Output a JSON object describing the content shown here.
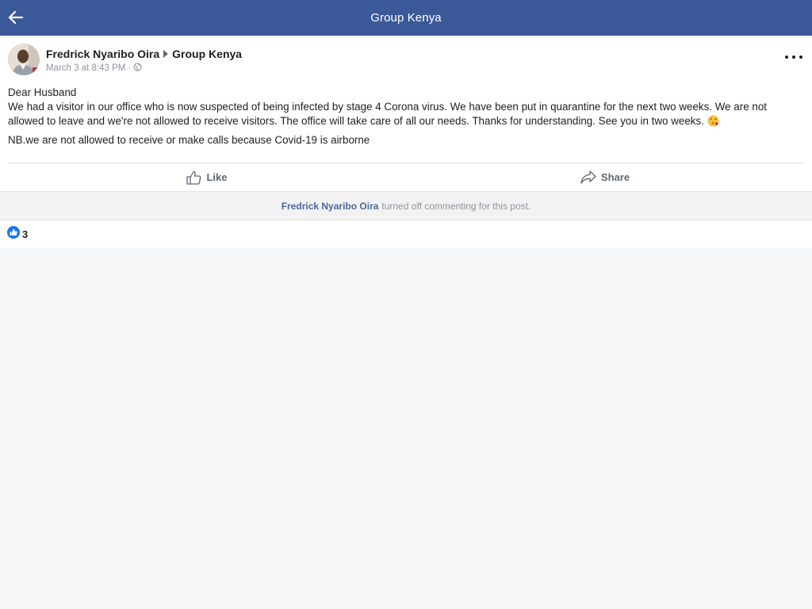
{
  "topbar": {
    "title": "Group Kenya",
    "back_icon": "arrow-left-icon",
    "background": "#3b5998"
  },
  "post": {
    "author": "Fredrick Nyaribo Oira",
    "group": "Group Kenya",
    "timestamp": "March 3 at 8:43 PM",
    "privacy_icon": "globe-icon",
    "body": {
      "greeting": "Dear Husband",
      "paragraph": "We had a visitor in our office who is now suspected of being infected by stage 4 Corona virus. We have been put in quarantine for the next two weeks. We are not allowed to leave and we're not allowed to receive visitors. The office will take care of all our needs. Thanks for understanding. See you in two weeks. ",
      "emoji": "face-blowing-kiss-emoji",
      "nb": "NB.we are not allowed to receive or make calls because Covid-19 is airborne"
    },
    "actions": {
      "like_label": "Like",
      "share_label": "Share"
    }
  },
  "comments_notice": {
    "author": "Fredrick Nyaribo Oira",
    "text": "turned off commenting for this post."
  },
  "reactions": {
    "icon": "like-reaction-icon",
    "count": "3",
    "color": "#1877f2"
  }
}
